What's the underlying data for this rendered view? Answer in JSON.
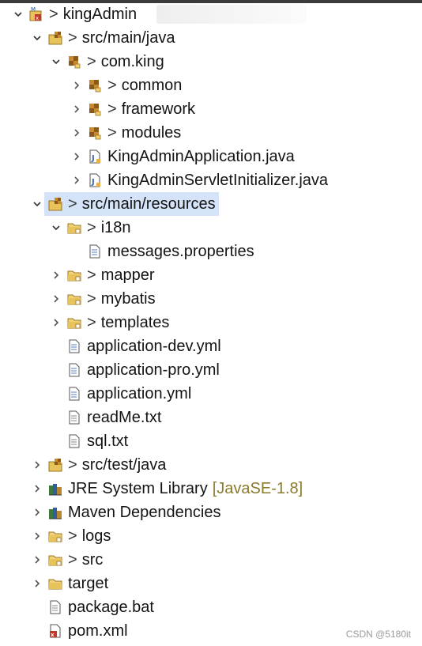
{
  "tree": {
    "items": [
      {
        "label": "kingAdmin",
        "icon": "project-icon"
      },
      {
        "label": "src/main/java",
        "icon": "source-folder-icon"
      },
      {
        "label": "com.king",
        "icon": "package-icon"
      },
      {
        "label": "common",
        "icon": "package-icon"
      },
      {
        "label": "framework",
        "icon": "package-icon"
      },
      {
        "label": "modules",
        "icon": "package-icon"
      },
      {
        "label": "KingAdminApplication.java",
        "icon": "java-file-icon"
      },
      {
        "label": "KingAdminServletInitializer.java",
        "icon": "java-file-icon"
      },
      {
        "label": "src/main/resources",
        "icon": "source-folder-icon"
      },
      {
        "label": "i18n",
        "icon": "folder-icon"
      },
      {
        "label": "messages.properties",
        "icon": "file-icon"
      },
      {
        "label": "mapper",
        "icon": "folder-icon"
      },
      {
        "label": "mybatis",
        "icon": "folder-icon"
      },
      {
        "label": "templates",
        "icon": "folder-icon"
      },
      {
        "label": "application-dev.yml",
        "icon": "file-icon"
      },
      {
        "label": "application-pro.yml",
        "icon": "file-icon"
      },
      {
        "label": "application.yml",
        "icon": "file-icon"
      },
      {
        "label": "readMe.txt",
        "icon": "file-icon"
      },
      {
        "label": "sql.txt",
        "icon": "file-icon"
      },
      {
        "label": "src/test/java",
        "icon": "source-folder-icon"
      },
      {
        "label": "JRE System Library",
        "decoration": "[JavaSE-1.8]",
        "icon": "library-icon"
      },
      {
        "label": "Maven Dependencies",
        "icon": "library-icon"
      },
      {
        "label": "logs",
        "icon": "folder-icon"
      },
      {
        "label": "src",
        "icon": "folder-icon"
      },
      {
        "label": "target",
        "icon": "folder-icon"
      },
      {
        "label": "package.bat",
        "icon": "file-icon"
      },
      {
        "label": "pom.xml",
        "icon": "xml-file-icon"
      }
    ],
    "selected": "src/main/resources"
  },
  "dirty_marker": ">",
  "watermark": "CSDN @5180it",
  "colors": {
    "selection": "#d4e3f7",
    "decoration": "#8a7a2a",
    "folder": "#e8c25a",
    "package": "#c98a2e",
    "java": "#3a64b5"
  }
}
